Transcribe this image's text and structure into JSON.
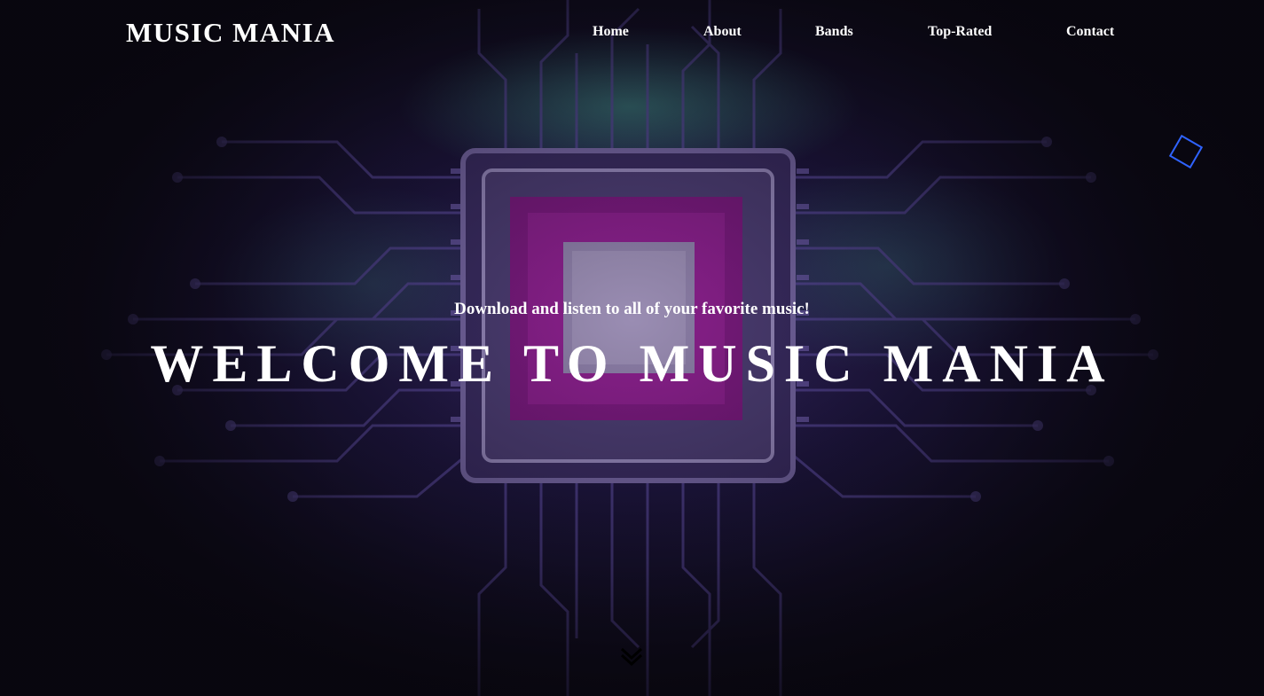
{
  "header": {
    "logo": "MUSIC MANIA",
    "nav": [
      {
        "label": "Home"
      },
      {
        "label": "About"
      },
      {
        "label": "Bands"
      },
      {
        "label": "Top-Rated"
      },
      {
        "label": "Contact"
      }
    ]
  },
  "hero": {
    "tagline": "Download and listen to all of your favorite music!",
    "headline": "WELCOME TO MUSIC MANIA",
    "background": "circuit-board-chip-image",
    "scroll_icon": "double-chevron-down-icon"
  },
  "colors": {
    "background": "#0b0912",
    "text": "#ffffff",
    "accent_diamond": "#2f63ff",
    "chip_magenta": "#8a1a86",
    "circuit_purple": "#5a3f9a",
    "circuit_teal": "#4fa89a"
  }
}
